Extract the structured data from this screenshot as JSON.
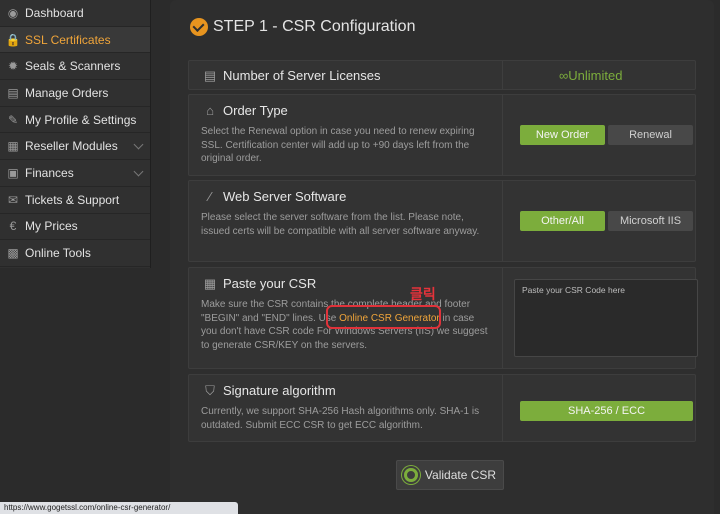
{
  "sidebar": {
    "items": [
      {
        "label": "Dashboard",
        "icon": "dashboard-icon",
        "glyph": "◉",
        "active": false,
        "chevron": false
      },
      {
        "label": "SSL Certificates",
        "icon": "lock-icon",
        "glyph": "🔒",
        "active": true,
        "chevron": false
      },
      {
        "label": "Seals & Scanners",
        "icon": "bug-icon",
        "glyph": "✹",
        "active": false,
        "chevron": false
      },
      {
        "label": "Manage Orders",
        "icon": "orders-icon",
        "glyph": "▤",
        "active": false,
        "chevron": false
      },
      {
        "label": "My Profile & Settings",
        "icon": "wrench-icon",
        "glyph": "✎",
        "active": false,
        "chevron": false
      },
      {
        "label": "Reseller Modules",
        "icon": "modules-icon",
        "glyph": "▦",
        "active": false,
        "chevron": true
      },
      {
        "label": "Finances",
        "icon": "finances-icon",
        "glyph": "▣",
        "active": false,
        "chevron": true
      },
      {
        "label": "Tickets & Support",
        "icon": "support-icon",
        "glyph": "✉",
        "active": false,
        "chevron": false
      },
      {
        "label": "My Prices",
        "icon": "euro-icon",
        "glyph": "€",
        "active": false,
        "chevron": false
      },
      {
        "label": "Online Tools",
        "icon": "tools-icon",
        "glyph": "▩",
        "active": false,
        "chevron": false
      }
    ]
  },
  "main": {
    "step_title": "STEP 1 - CSR Configuration",
    "licenses": {
      "label": "Number of Server Licenses",
      "value": "∞Unlimited"
    },
    "order_type": {
      "title": "Order Type",
      "desc": "Select the Renewal option in case you need to renew expiring SSL. Certification center will add up to +90 days left from the original order.",
      "options": [
        "New Order",
        "Renewal"
      ],
      "selected": "New Order"
    },
    "server_software": {
      "title": "Web Server Software",
      "desc": "Please select the server software from the list. Please note, issued certs will be compatible with all server software anyway.",
      "options": [
        "Other/All",
        "Microsoft IIS"
      ],
      "selected": "Other/All"
    },
    "paste_csr": {
      "title": "Paste your CSR",
      "desc_1": "Make sure the CSR contains the complete header and footer \"BEGIN\" and \"END\" lines. Use ",
      "link": "Online CSR Generator",
      "desc_2": " in case you don't have CSR code For Windows Servers (IIS) we suggest to generate CSR/KEY on the servers.",
      "placeholder": "Paste your CSR Code here"
    },
    "signature": {
      "title": "Signature algorithm",
      "desc": "Currently, we support SHA-256 Hash algorithms only. SHA-1 is outdated. Submit ECC CSR to get ECC algorithm.",
      "value": "SHA-256 / ECC"
    },
    "validate_label": "Validate CSR"
  },
  "annotation": "클릭",
  "statusbar_url": "https://www.gogetssl.com/online-csr-generator/",
  "colors": {
    "accent_orange": "#f0a53a",
    "green": "#7cad3c",
    "highlight_red": "#e0323a"
  }
}
